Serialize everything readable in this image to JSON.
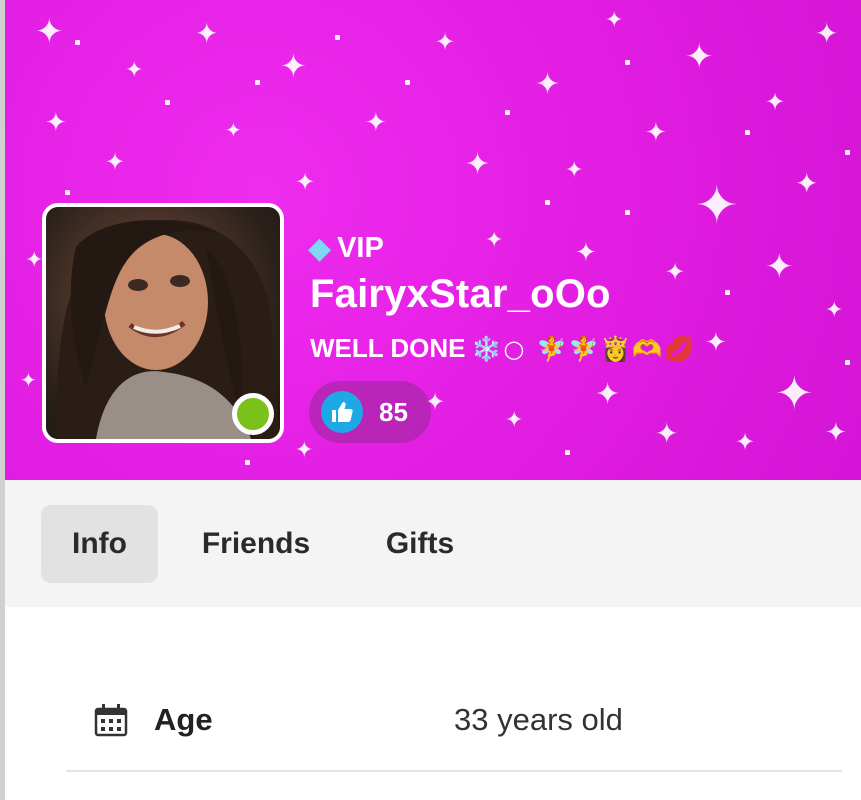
{
  "profile": {
    "vip_icon": "diamond-icon",
    "vip_label": "VIP",
    "username": "FairyxStar_oOo",
    "status_text": "WELL DONE",
    "status_emojis": "❄️○ 🧚🧚👸🫶💋",
    "likes_icon": "thumbs-up-icon",
    "likes_count": "85",
    "online": true
  },
  "tabs": [
    {
      "label": "Info",
      "active": true
    },
    {
      "label": "Friends",
      "active": false
    },
    {
      "label": "Gifts",
      "active": false
    }
  ],
  "info": {
    "age_icon": "calendar-icon",
    "age_label": "Age",
    "age_value": "33 years old"
  },
  "colors": {
    "banner": "#e31fe3",
    "online": "#7bc11b",
    "like": "#1da9e6",
    "tab_active": "#e2e2e2",
    "tabs_bar": "#f4f4f4"
  }
}
